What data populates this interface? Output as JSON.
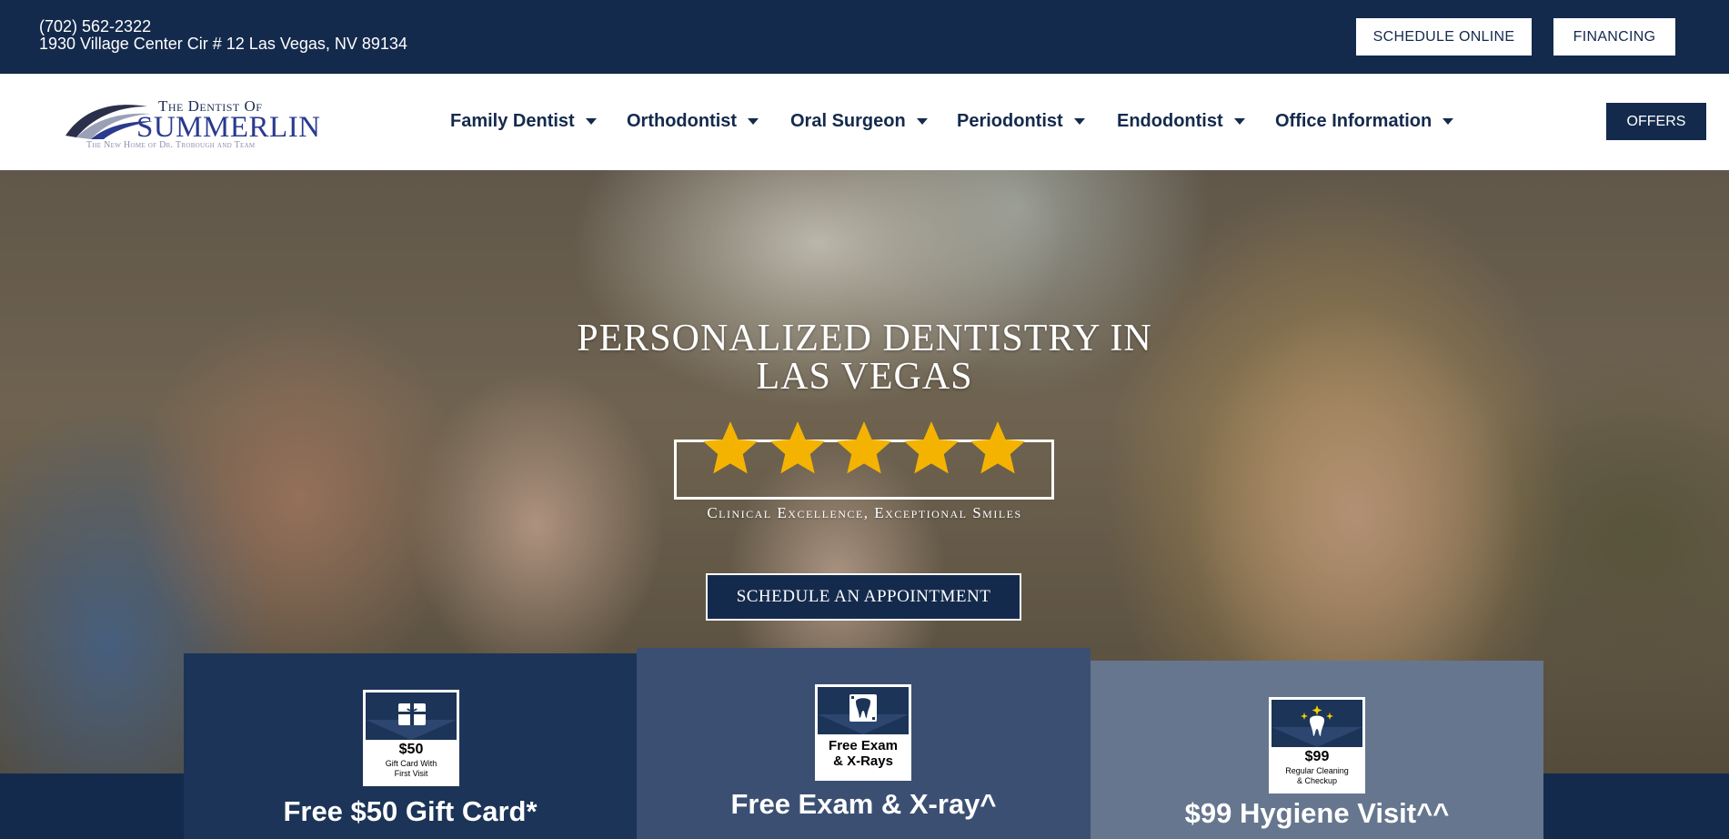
{
  "topbar": {
    "phone": "(702) 562-2322",
    "address": "1930 Village Center Cir # 12 Las Vegas, NV 89134",
    "schedule_label": "SCHEDULE ONLINE",
    "financing_label": "FINANCING"
  },
  "logo": {
    "line1": "The Dentist Of",
    "line2": "SUMMERLIN",
    "line3": "The New Home of Dr. Trobough and Team"
  },
  "nav": {
    "items": [
      {
        "label": "Family Dentist"
      },
      {
        "label": "Orthodontist"
      },
      {
        "label": "Oral Surgeon"
      },
      {
        "label": "Periodontist"
      },
      {
        "label": "Endodontist"
      },
      {
        "label": "Office Information"
      }
    ],
    "offers_label": "OFFERS"
  },
  "hero": {
    "title_line1": "PERSONALIZED DENTISTRY IN",
    "title_line2": "LAS VEGAS",
    "rating_stars": 5,
    "tagline": "Clinical Excellence, Exceptional Smiles",
    "cta_label": "SCHEDULE AN APPOINTMENT"
  },
  "offers": [
    {
      "coupon_big": "$50",
      "coupon_small": "Gift Card With\nFirst Visit",
      "icon": "gift-icon",
      "headline": "Free $50 Gift Card*"
    },
    {
      "coupon_big": "Free Exam\n& X-Rays",
      "coupon_small": "",
      "icon": "tooth-xray-icon",
      "headline": "Free Exam & X-ray^"
    },
    {
      "coupon_big": "$99",
      "coupon_small": "Regular Cleaning\n& Checkup",
      "icon": "sparkle-tooth-icon",
      "headline": "$99 Hygiene Visit^^"
    }
  ],
  "colors": {
    "navy": "#142a4d",
    "star": "#f5b301",
    "card1": "#1c3457",
    "card2": "#3b4f72",
    "card3": "#66768f"
  }
}
